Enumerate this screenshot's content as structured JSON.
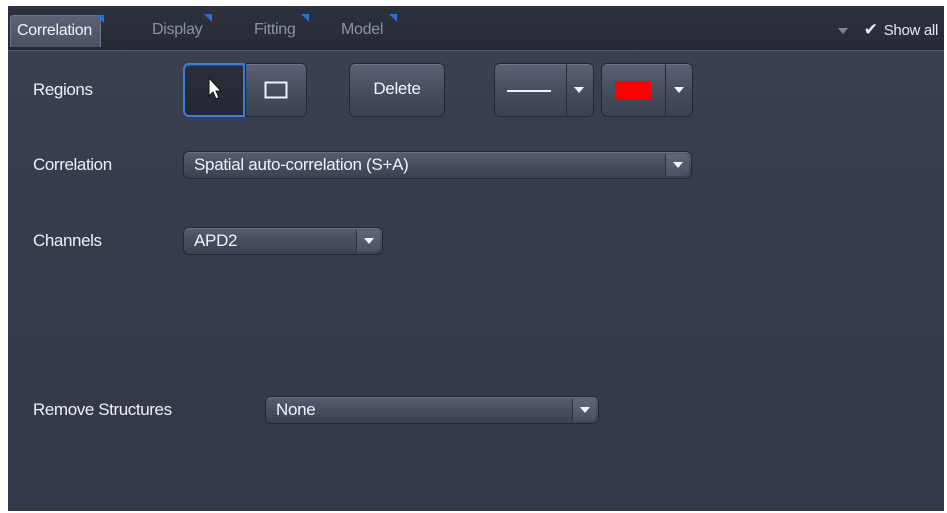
{
  "tabs": [
    {
      "label": "Correlation",
      "active": true
    },
    {
      "label": "Display",
      "active": false
    },
    {
      "label": "Fitting",
      "active": false
    },
    {
      "label": "Model",
      "active": false
    }
  ],
  "show_all": {
    "label": "Show all",
    "checked": true
  },
  "regions": {
    "label": "Regions",
    "pointer_tool_icon": "cursor-arrow-icon",
    "rectangle_tool_icon": "rectangle-icon",
    "delete_label": "Delete",
    "line_style_icon": "line-style-icon",
    "color_swatch": "#ff0000"
  },
  "correlation": {
    "label": "Correlation",
    "value": "Spatial auto-correlation (S+A)"
  },
  "channels": {
    "label": "Channels",
    "value": "APD2"
  },
  "remove_structures": {
    "label": "Remove Structures",
    "value": "None"
  },
  "colors": {
    "panel_bg": "#363c4b",
    "tab_accent": "#2f6fd6",
    "selected_border": "#3d7bdc"
  }
}
